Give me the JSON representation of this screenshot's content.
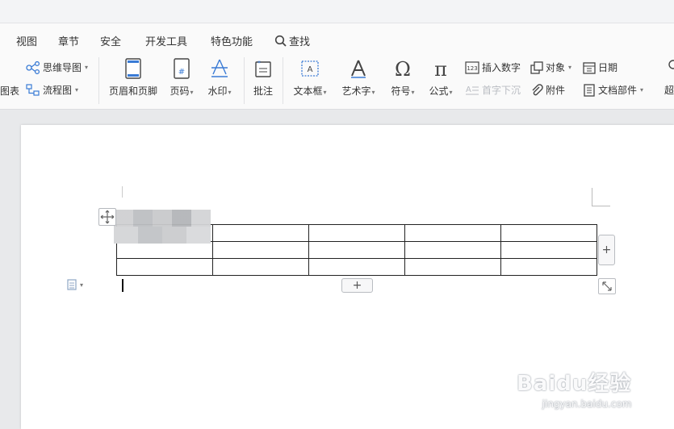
{
  "menu": {
    "items": [
      "视图",
      "章节",
      "安全",
      "开发工具",
      "特色功能"
    ],
    "search_label": "查找"
  },
  "ribbon": {
    "chart_partial": "图表",
    "mindmap": "思维导图",
    "flowchart": "流程图",
    "header_footer": "页眉和页脚",
    "page_number": "页码",
    "watermark": "水印",
    "comment": "批注",
    "textbox": "文本框",
    "wordart": "艺术字",
    "symbol": "符号",
    "formula": "公式",
    "insert_number": "插入数字",
    "drop_cap": "首字下沉",
    "object": "对象",
    "attachment": "附件",
    "date": "日期",
    "doc_parts": "文档部件",
    "overflow_partial": "超"
  },
  "table": {
    "rows": 3,
    "cols": 5
  },
  "table_controls": {
    "add_column": "+",
    "add_row": "+"
  },
  "watermark": {
    "brand": "Baidu经验",
    "url": "jingyan.baidu.com"
  },
  "colors": {
    "accent": "#3a7bd5",
    "disabled": "#b9bcc2",
    "border": "#222222"
  }
}
